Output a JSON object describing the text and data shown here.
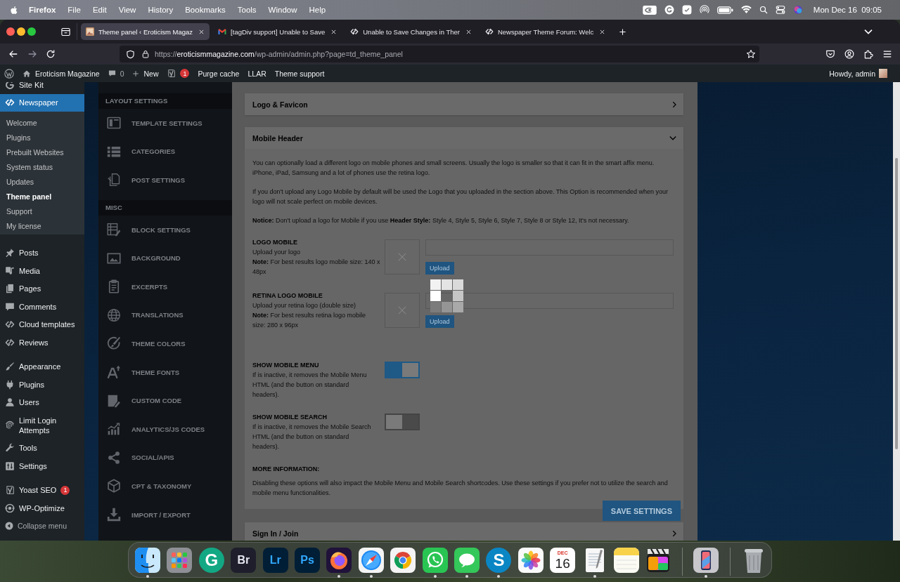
{
  "menubar": {
    "app": "Firefox",
    "menus": [
      "File",
      "Edit",
      "View",
      "History",
      "Bookmarks",
      "Tools",
      "Window",
      "Help"
    ],
    "clock": "Mon Dec 16  09:05"
  },
  "browser": {
    "tabs": [
      {
        "title": "Theme panel ‹ Eroticism Magaz",
        "selected": true
      },
      {
        "title": "[tagDiv support] Unable to Save",
        "selected": false
      },
      {
        "title": "Unable to Save Changes in Ther",
        "selected": false
      },
      {
        "title": "Newspaper Theme Forum: Welc",
        "selected": false
      }
    ],
    "back_enabled": true,
    "forward_enabled": false,
    "url": {
      "scheme": "https://",
      "host": "eroticismmagazine.com",
      "path": "/wp-admin/admin.php?page=td_theme_panel"
    }
  },
  "admin_bar": {
    "site_name": "Eroticism Magazine",
    "comment_count": "0",
    "new_label": "New",
    "seo_badge": "1",
    "links": [
      "Purge cache",
      "LLAR",
      "Theme support"
    ],
    "greeting": "Howdy, admin"
  },
  "admin_menu": {
    "groups": [
      [
        {
          "label": "Site Kit",
          "selected": false
        },
        {
          "label": "Newspaper",
          "selected": true,
          "children": [
            {
              "label": "Welcome",
              "selected": false
            },
            {
              "label": "Plugins",
              "selected": false
            },
            {
              "label": "Prebuilt Websites",
              "selected": false
            },
            {
              "label": "System status",
              "selected": false
            },
            {
              "label": "Updates",
              "selected": false
            },
            {
              "label": "Theme panel",
              "selected": true
            },
            {
              "label": "Support",
              "selected": false
            },
            {
              "label": "My license",
              "selected": false
            }
          ]
        },
        {
          "label": "Posts",
          "selected": false
        },
        {
          "label": "Media",
          "selected": false
        },
        {
          "label": "Pages",
          "selected": false
        },
        {
          "label": "Comments",
          "selected": false
        },
        {
          "label": "Cloud templates",
          "selected": false
        },
        {
          "label": "Reviews",
          "selected": false
        }
      ],
      [
        {
          "label": "Appearance",
          "selected": false
        },
        {
          "label": "Plugins",
          "selected": false
        },
        {
          "label": "Users",
          "selected": false
        },
        {
          "label": "Limit Login Attempts",
          "selected": false
        },
        {
          "label": "Tools",
          "selected": false
        },
        {
          "label": "Settings",
          "selected": false
        }
      ],
      [
        {
          "label": "Yoast SEO",
          "selected": false,
          "badge": "1"
        },
        {
          "label": "WP-Optimize",
          "selected": false
        }
      ]
    ],
    "collapse_label": "Collapse menu"
  },
  "theme_panel": {
    "loading": true,
    "nav": [
      {
        "title": "LAYOUT SETTINGS",
        "items": [
          {
            "label": "TEMPLATE SETTINGS",
            "selected": false
          },
          {
            "label": "CATEGORIES",
            "selected": false
          },
          {
            "label": "POST SETTINGS",
            "selected": false
          }
        ]
      },
      {
        "title": "MISC",
        "items": [
          {
            "label": "BLOCK SETTINGS",
            "selected": false
          },
          {
            "label": "BACKGROUND",
            "selected": false
          },
          {
            "label": "EXCERPTS",
            "selected": false
          },
          {
            "label": "TRANSLATIONS",
            "selected": false
          },
          {
            "label": "THEME COLORS",
            "selected": false
          },
          {
            "label": "THEME FONTS",
            "selected": false
          },
          {
            "label": "CUSTOM CODE",
            "selected": false
          },
          {
            "label": "ANALYTICS/JS CODES",
            "selected": false
          },
          {
            "label": "SOCIAL/APIS",
            "selected": false
          },
          {
            "label": "CPT & TAXONOMY",
            "selected": false
          },
          {
            "label": "IMPORT / EXPORT",
            "selected": false
          }
        ]
      }
    ],
    "sections": [
      {
        "title": "Logo & Favicon",
        "expanded": false
      },
      {
        "title": "Mobile Header",
        "expanded": true,
        "intro": [
          "You can optionally load a different logo on mobile phones and small screens. Usually the logo is smaller so that it can fit in the smart affix menu. iPhone, iPad, Samsung and a lot of phones use the retina logo.",
          "If you don't upload any Logo Mobile by default will be used the Logo that you uploaded in the section above. This Option is recommended when your logo will not scale perfect on mobile devices.",
          "**Notice:** Don't upload a logo for Mobile if you use **Header Style:** Style 4, Style 5, Style 6, Style 7, Style 8 or Style 12, It's not necessary."
        ],
        "fields": [
          {
            "kind": "upload",
            "label": "LOGO MOBILE",
            "hint": "Upload your logo",
            "note": "**Note:** For best results logo mobile size: 140 x 48px",
            "button": "Upload"
          },
          {
            "kind": "upload",
            "label": "RETINA LOGO MOBILE",
            "hint": "Upload your retina logo (double size)",
            "note": "**Note:** For best results retina logo mobile size: 280 x 96px",
            "button": "Upload"
          },
          {
            "kind": "toggle",
            "label": "SHOW MOBILE MENU",
            "hint": "If is inactive, it removes the Mobile Menu HTML (and the button on standard headers).",
            "on": true
          },
          {
            "kind": "toggle",
            "label": "SHOW MOBILE SEARCH",
            "hint": "If is inactive, it removes the Mobile Search HTML (and the button on standard headers).",
            "on": false
          },
          {
            "kind": "info",
            "label": "MORE INFORMATION:",
            "hint": "Disabling these options will also impact the Mobile Menu and Mobile Search shortcodes. Use these settings if you prefer not to utilize the search and mobile menu functionalities."
          }
        ]
      },
      {
        "title": "Sign In / Join",
        "expanded": false
      }
    ],
    "save_label": "SAVE SETTINGS"
  },
  "dock": {
    "groups": [
      [
        {
          "running": true
        },
        {
          "running": false
        },
        {
          "running": false,
          "label": "G"
        },
        {
          "running": false,
          "label": "Br"
        },
        {
          "running": false,
          "label": "Lr"
        },
        {
          "running": false,
          "label": "Ps"
        },
        {
          "running": true
        },
        {
          "running": true
        },
        {
          "running": false
        },
        {
          "running": true
        },
        {
          "running": true
        },
        {
          "running": true,
          "label": "S"
        },
        {
          "running": false
        },
        {
          "running": false,
          "month": "DEC",
          "day": "16"
        },
        {
          "running": true
        },
        {
          "running": false
        },
        {
          "running": false
        }
      ],
      [
        {
          "running": true
        }
      ],
      [
        {
          "running": false
        }
      ]
    ]
  }
}
